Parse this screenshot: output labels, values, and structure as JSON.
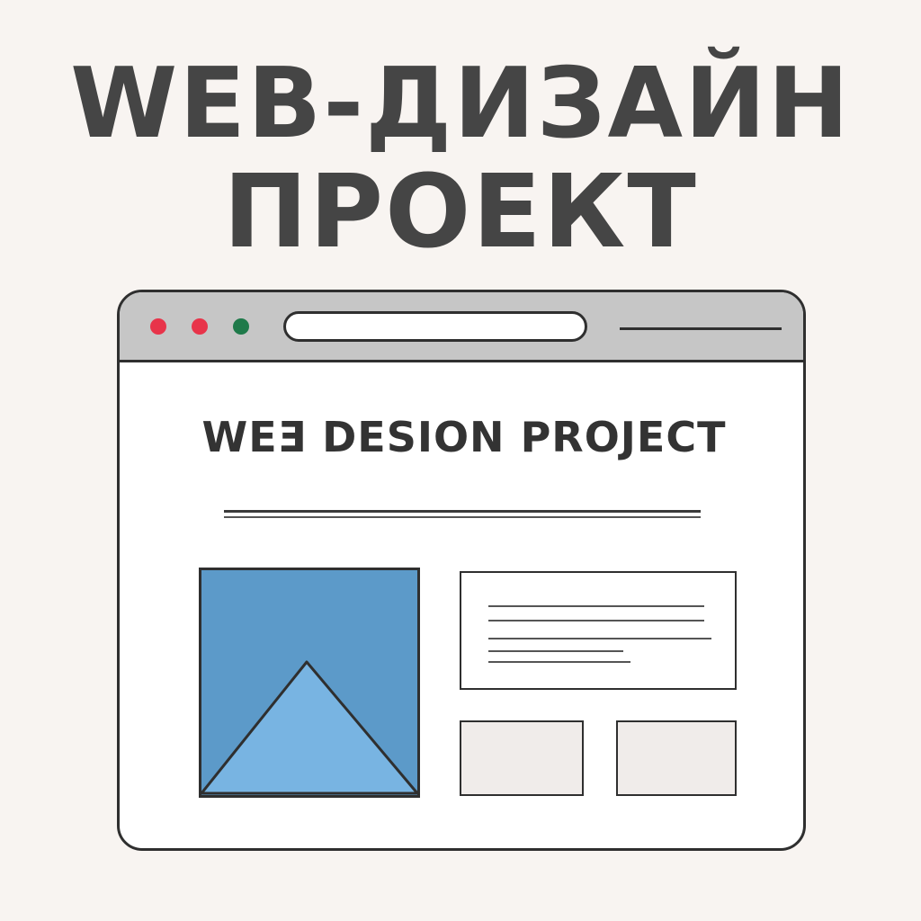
{
  "headline": {
    "line1": "WEB-ДИЗАЙН",
    "line2": "ПРОЕКТ"
  },
  "browser": {
    "window_controls": [
      {
        "name": "close",
        "color": "#e8344a"
      },
      {
        "name": "minimize",
        "color": "#e8344a"
      },
      {
        "name": "maximize",
        "color": "#1f7a4a"
      }
    ],
    "page_title": "WEƎ DESION PROJECT"
  },
  "colors": {
    "background": "#f8f4f1",
    "text": "#454545",
    "titlebar": "#c6c6c6",
    "image_bg": "#5c9ac9",
    "mountain": "#78b4e2",
    "card_fill": "#f0ecea"
  }
}
